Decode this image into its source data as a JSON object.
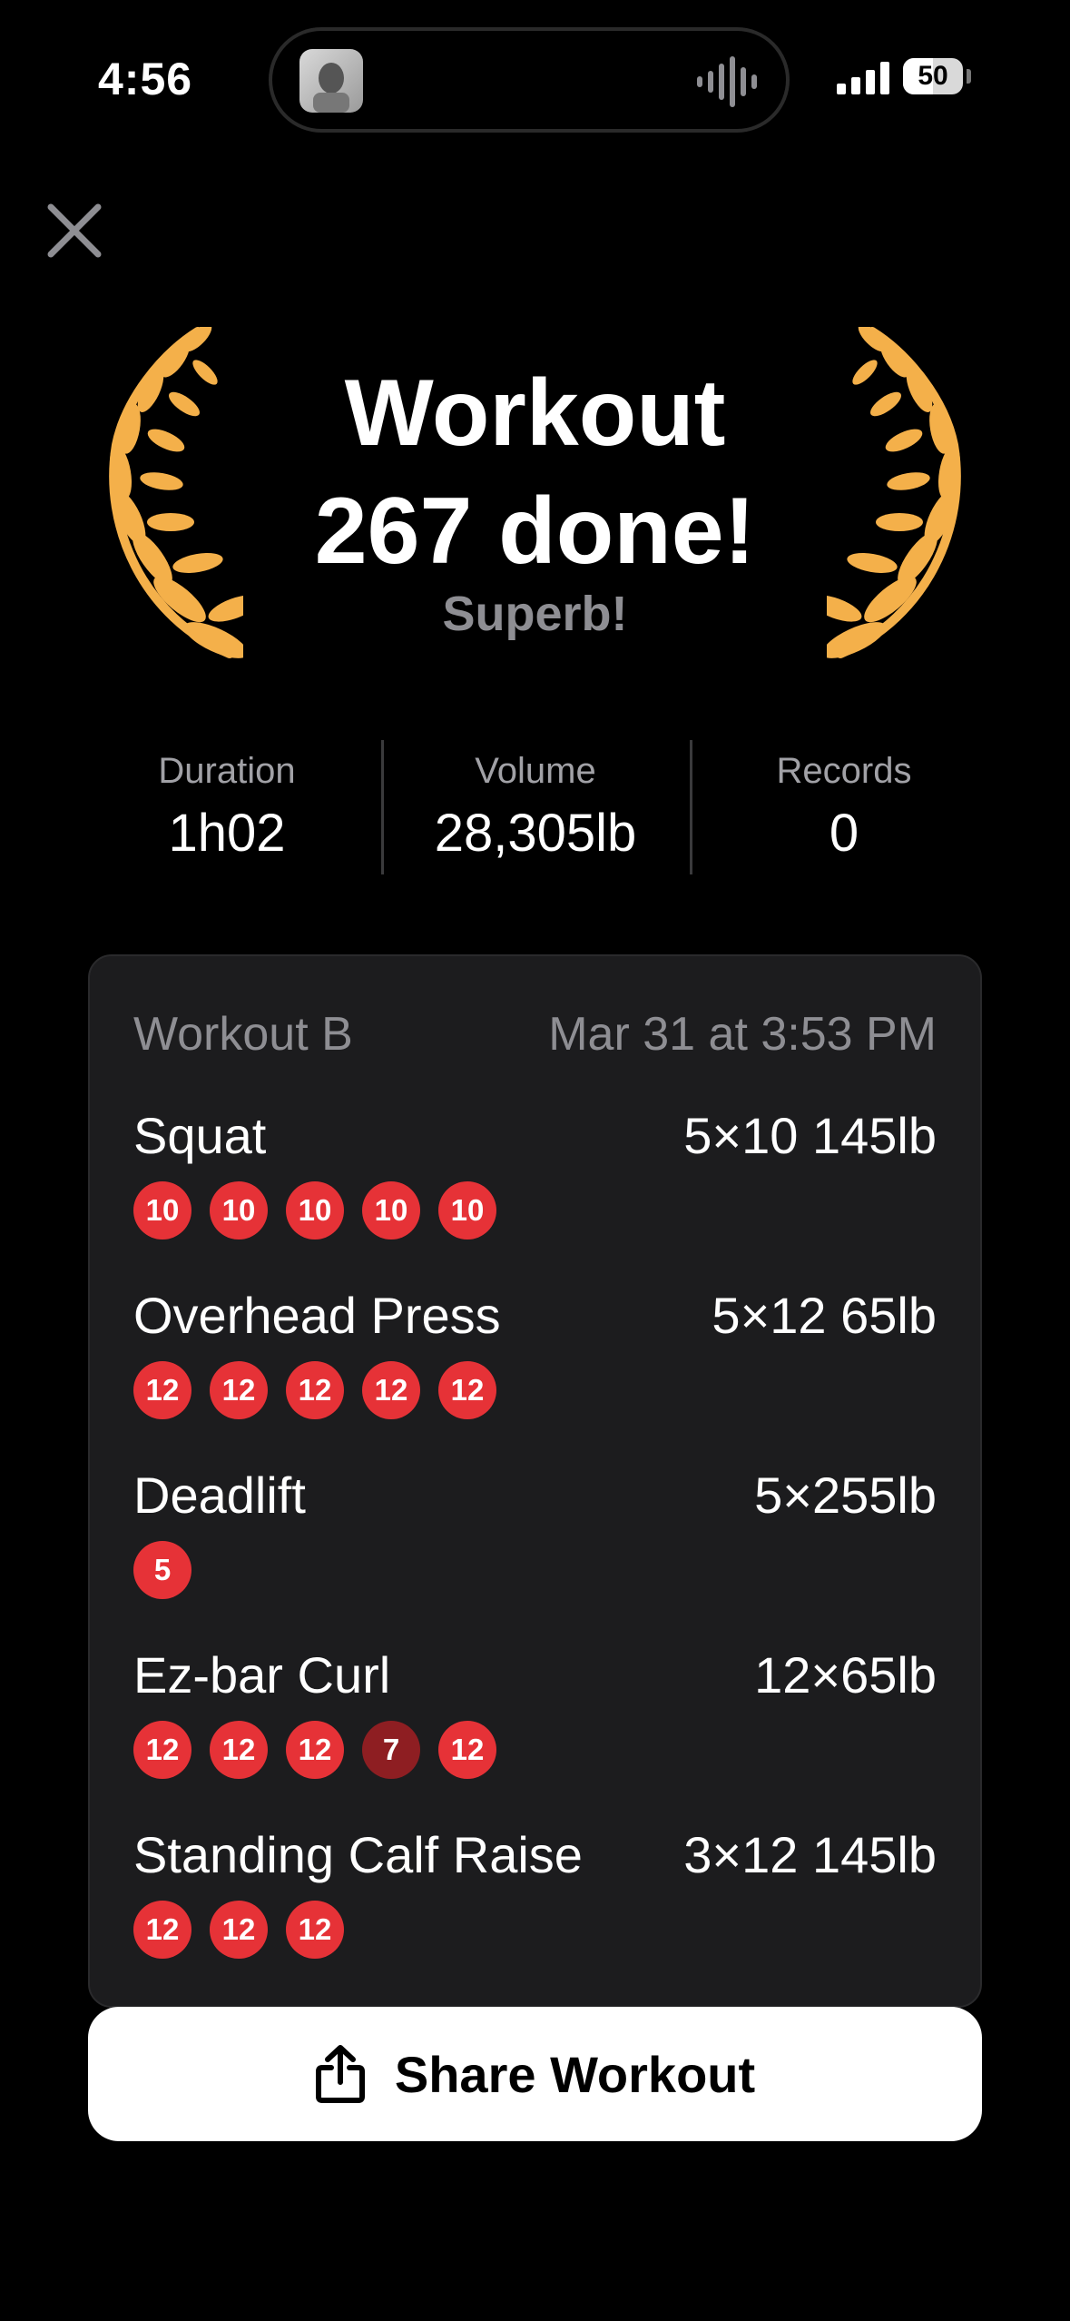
{
  "status_bar": {
    "time": "4:56",
    "battery": "50"
  },
  "hero": {
    "title_line1": "Workout",
    "title_line2": "267 done!",
    "subtitle": "Superb!"
  },
  "stats": [
    {
      "label": "Duration",
      "value": "1h02"
    },
    {
      "label": "Volume",
      "value": "28,305lb"
    },
    {
      "label": "Records",
      "value": "0"
    }
  ],
  "card": {
    "name": "Workout B",
    "date": "Mar 31 at 3:53 PM",
    "exercises": [
      {
        "name": "Squat",
        "summary": "5×10 145lb",
        "sets": [
          "10",
          "10",
          "10",
          "10",
          "10"
        ]
      },
      {
        "name": "Overhead Press",
        "summary": "5×12 65lb",
        "sets": [
          "12",
          "12",
          "12",
          "12",
          "12"
        ]
      },
      {
        "name": "Deadlift",
        "summary": "5×255lb",
        "sets": [
          "5"
        ]
      },
      {
        "name": "Ez-bar Curl",
        "summary": "12×65lb",
        "sets": [
          "12",
          "12",
          "12",
          "7",
          "12"
        ]
      },
      {
        "name": "Standing Calf Raise",
        "summary": "3×12 145lb",
        "sets": [
          "12",
          "12",
          "12"
        ]
      }
    ]
  },
  "share_button": {
    "label": "Share Workout"
  },
  "colors": {
    "background": "#000000",
    "card": "#1c1c1e",
    "set_complete": "#e63237",
    "set_partial": "#8e1e22",
    "laurel": "#f4b04a"
  },
  "icons": [
    "close-icon",
    "laurel-icon",
    "share-icon",
    "signal-icon",
    "battery-icon"
  ]
}
